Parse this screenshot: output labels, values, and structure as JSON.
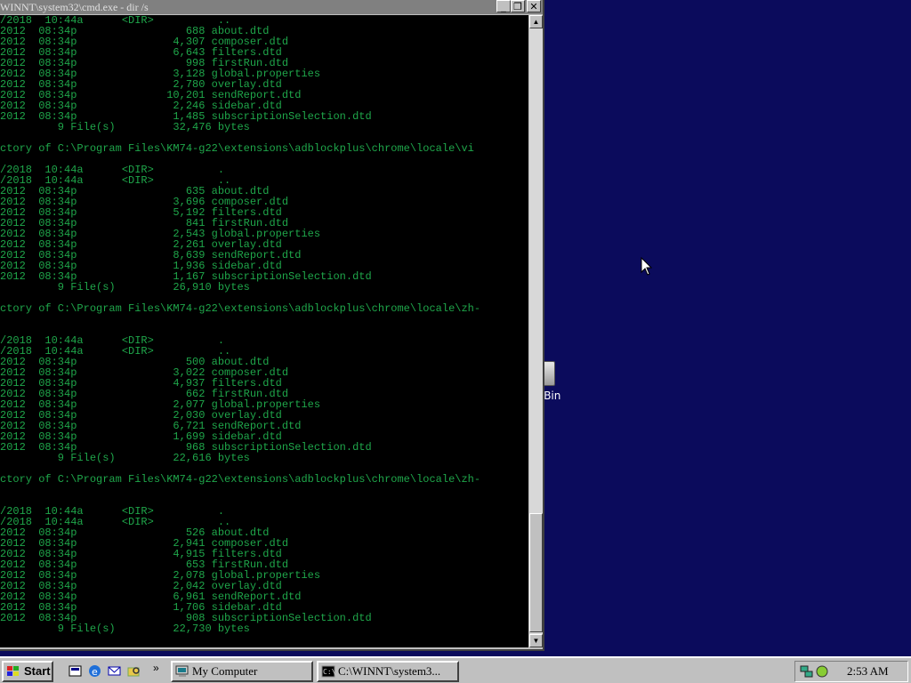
{
  "window": {
    "title": "WINNT\\system32\\cmd.exe - dir /s",
    "minimize_glyph": "_",
    "maximize_glyph": "❐",
    "close_glyph": "✕"
  },
  "console_lines": [
    "/2018  10:44a      <DIR>          ..",
    "2012  08:34p                 688 about.dtd",
    "2012  08:34p               4,307 composer.dtd",
    "2012  08:34p               6,643 filters.dtd",
    "2012  08:34p                 998 firstRun.dtd",
    "2012  08:34p               3,128 global.properties",
    "2012  08:34p               2,780 overlay.dtd",
    "2012  08:34p              10,201 sendReport.dtd",
    "2012  08:34p               2,246 sidebar.dtd",
    "2012  08:34p               1,485 subscriptionSelection.dtd",
    "         9 File(s)         32,476 bytes",
    "",
    "ctory of C:\\Program Files\\KM74-g22\\extensions\\adblockplus\\chrome\\locale\\vi",
    "",
    "/2018  10:44a      <DIR>          .",
    "/2018  10:44a      <DIR>          ..",
    "2012  08:34p                 635 about.dtd",
    "2012  08:34p               3,696 composer.dtd",
    "2012  08:34p               5,192 filters.dtd",
    "2012  08:34p                 841 firstRun.dtd",
    "2012  08:34p               2,543 global.properties",
    "2012  08:34p               2,261 overlay.dtd",
    "2012  08:34p               8,639 sendReport.dtd",
    "2012  08:34p               1,936 sidebar.dtd",
    "2012  08:34p               1,167 subscriptionSelection.dtd",
    "         9 File(s)         26,910 bytes",
    "",
    "ctory of C:\\Program Files\\KM74-g22\\extensions\\adblockplus\\chrome\\locale\\zh-",
    "",
    "",
    "/2018  10:44a      <DIR>          .",
    "/2018  10:44a      <DIR>          ..",
    "2012  08:34p                 500 about.dtd",
    "2012  08:34p               3,022 composer.dtd",
    "2012  08:34p               4,937 filters.dtd",
    "2012  08:34p                 662 firstRun.dtd",
    "2012  08:34p               2,077 global.properties",
    "2012  08:34p               2,030 overlay.dtd",
    "2012  08:34p               6,721 sendReport.dtd",
    "2012  08:34p               1,699 sidebar.dtd",
    "2012  08:34p                 968 subscriptionSelection.dtd",
    "         9 File(s)         22,616 bytes",
    "",
    "ctory of C:\\Program Files\\KM74-g22\\extensions\\adblockplus\\chrome\\locale\\zh-",
    "",
    "",
    "/2018  10:44a      <DIR>          .",
    "/2018  10:44a      <DIR>          ..",
    "2012  08:34p                 526 about.dtd",
    "2012  08:34p               2,941 composer.dtd",
    "2012  08:34p               4,915 filters.dtd",
    "2012  08:34p                 653 firstRun.dtd",
    "2012  08:34p               2,078 global.properties",
    "2012  08:34p               2,042 overlay.dtd",
    "2012  08:34p               6,961 sendReport.dtd",
    "2012  08:34p               1,706 sidebar.dtd",
    "2012  08:34p                 908 subscriptionSelection.dtd",
    "         9 File(s)         22,730 bytes"
  ],
  "desktop": {
    "recycle_bin_label": "e Bin"
  },
  "taskbar": {
    "start_label": "Start",
    "quick_launch_icons": [
      "show-desktop-icon",
      "internet-explorer-icon",
      "outlook-express-icon",
      "windows-explorer-icon"
    ],
    "overflow_label": "»",
    "tasks": [
      {
        "label": "My Computer",
        "icon": "my-computer-icon"
      },
      {
        "label": "C:\\WINNT\\system3...",
        "icon": "cmd-icon"
      }
    ],
    "clock": "2:53 AM"
  },
  "colors": {
    "desktop": "#0b0b5c",
    "console_text": "#1fa64a",
    "console_bg": "#000000",
    "title_inactive": "#808080"
  }
}
